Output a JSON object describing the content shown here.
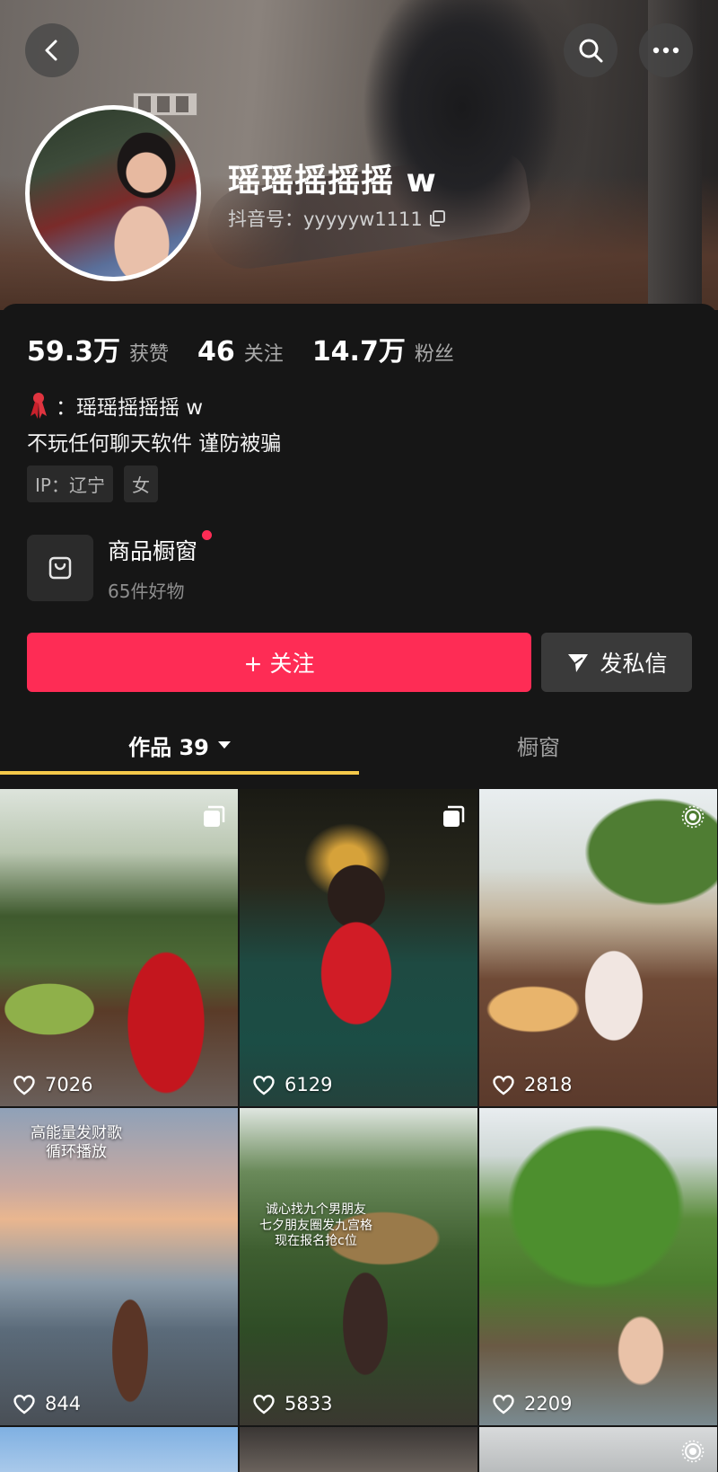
{
  "profile": {
    "name": "瑶瑶摇摇摇 w",
    "douyin_id": "抖音号：yyyyyw1111"
  },
  "stats": [
    {
      "num": "59.3万",
      "label": "获赞"
    },
    {
      "num": "46",
      "label": "关注"
    },
    {
      "num": "14.7万",
      "label": "粉丝"
    }
  ],
  "bio": {
    "line1": "：瑶瑶摇摇摇 w",
    "line2": "不玩任何聊天软件 谨防被骗"
  },
  "tags": [
    "IP：辽宁",
    "女"
  ],
  "shop": {
    "title": "商品橱窗",
    "subtitle": "65件好物"
  },
  "actions": {
    "follow": "+ 关注",
    "message": "发私信"
  },
  "tabs": {
    "works": "作品 39",
    "showcase": "橱窗"
  },
  "videos": [
    {
      "likes": "7026",
      "icon": "multi-image-icon"
    },
    {
      "likes": "6129",
      "icon": "multi-image-icon"
    },
    {
      "likes": "2818",
      "icon": "live-photo-icon"
    },
    {
      "likes": "844",
      "icon": "",
      "overlay": [
        "高能量发财歌",
        "循环播放"
      ]
    },
    {
      "likes": "5833",
      "icon": "",
      "overlay": [
        "诚心找九个男朋友",
        "七夕朋友圈发九宫格",
        "现在报名抢c位"
      ]
    },
    {
      "likes": "2209",
      "icon": ""
    }
  ],
  "colors": {
    "accent": "#fe2c55",
    "tab_underline": "#f4c84a",
    "background": "#161616"
  }
}
